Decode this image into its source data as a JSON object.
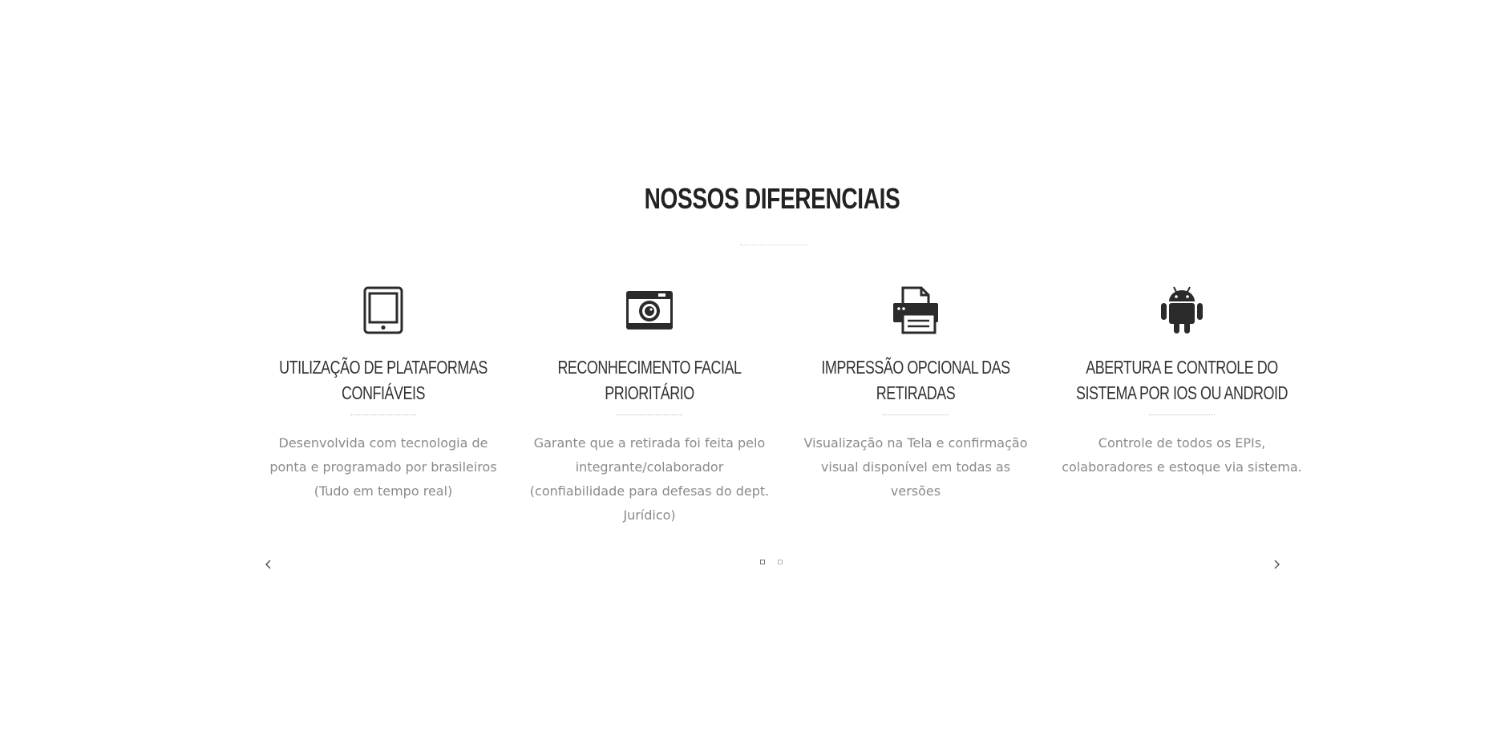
{
  "section": {
    "title": "NOSSOS DIFERENCIAIS"
  },
  "features": [
    {
      "icon": "tablet-icon",
      "title": "UTILIZAÇÃO DE PLATAFORMAS CONFIÁVEIS",
      "description": "Desenvolvida com tecnologia de ponta e programado por brasileiros (Tudo em tempo real)"
    },
    {
      "icon": "camera-icon",
      "title": "RECONHECIMENTO FACIAL PRIORITÁRIO",
      "description": "Garante que a retirada foi feita pelo integrante/colaborador (confiabilidade para defesas do dept. Jurídico)"
    },
    {
      "icon": "printer-icon",
      "title": "IMPRESSÃO OPCIONAL DAS RETIRADAS",
      "description": "Visualização na Tela e confirmação visual disponível em todas as versões"
    },
    {
      "icon": "android-icon",
      "title": "ABERTURA E CONTROLE DO SISTEMA POR IOS OU ANDROID",
      "description": "Controle de todos os EPIs, colaboradores e estoque via sistema."
    }
  ],
  "carousel": {
    "prev_icon": "chevron-left-icon",
    "next_icon": "chevron-right-icon",
    "pages": 2,
    "active_page": 1
  },
  "colors": {
    "title": "#222222",
    "feature_title": "#333333",
    "text": "#8a8a8a",
    "icon": "#2b2b2b"
  }
}
